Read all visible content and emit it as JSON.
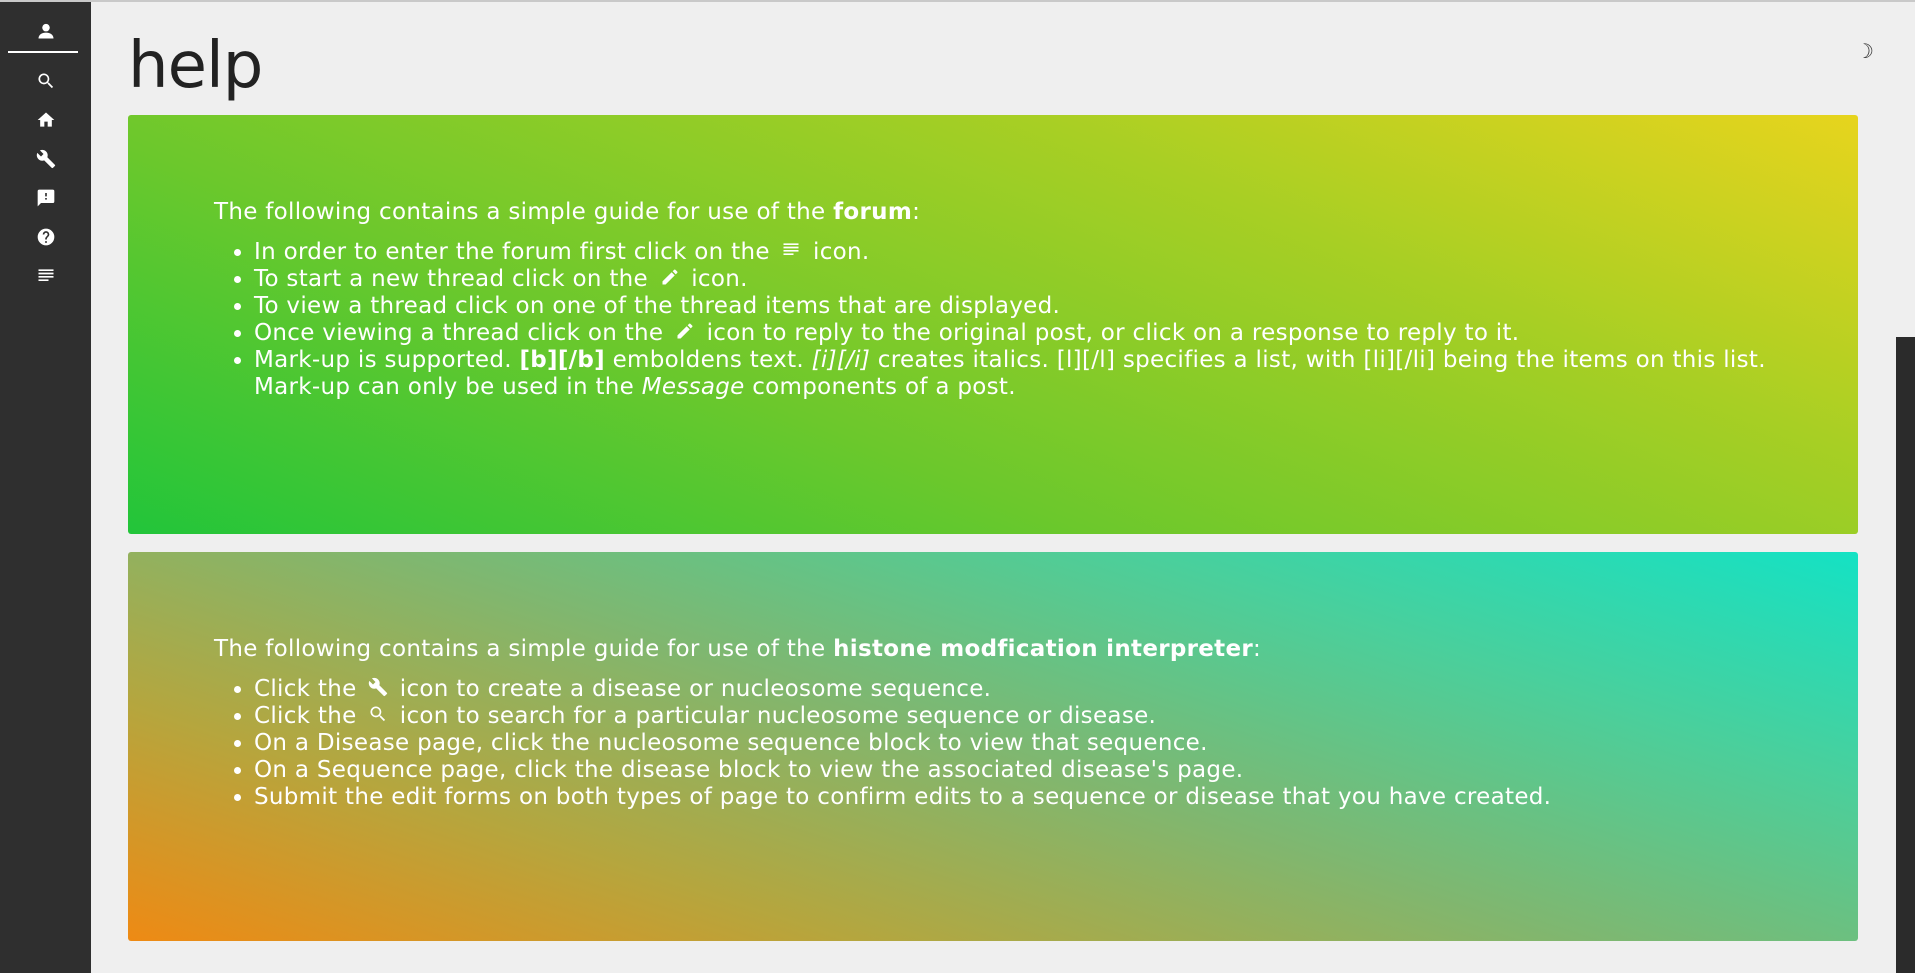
{
  "page": {
    "title": "help",
    "theme_toggle_glyph": "☽"
  },
  "sidebar": {
    "items": [
      {
        "name": "user-icon"
      },
      {
        "name": "search-icon"
      },
      {
        "name": "home-icon"
      },
      {
        "name": "wrench-icon"
      },
      {
        "name": "feedback-icon"
      },
      {
        "name": "help-icon"
      },
      {
        "name": "forum-icon"
      }
    ]
  },
  "forum": {
    "intro": "The following contains a simple guide for use of the ",
    "intro_bold": "forum",
    "intro_end": ":",
    "items": {
      "i1_a": "In order to enter the forum first click on the ",
      "i1_b": " icon.",
      "i2_a": "To start a new thread click on the ",
      "i2_b": " icon.",
      "i3": "To view a thread click on one of the thread items that are displayed.",
      "i4_a": "Once viewing a thread click on the ",
      "i4_b": " icon to reply to the original post, or click on a response to reply to it.",
      "i5_a": "Mark-up is supported. ",
      "i5_bold": "[b][/b]",
      "i5_b": " emboldens text. ",
      "i5_ital": "[i][/i]",
      "i5_c": " creates italics. [l][/l] specifies a list, with [li][/li] being the items on this list. Mark-up can only be used in the ",
      "i5_msg": "Message",
      "i5_d": " components of a post."
    }
  },
  "histone": {
    "intro": "The following contains a simple guide for use of the ",
    "intro_bold": "histone modfication interpreter",
    "intro_end": ":",
    "items": {
      "i1_a": "Click the ",
      "i1_b": " icon to create a disease or nucleosome sequence.",
      "i2_a": "Click the ",
      "i2_b": " icon to search for a particular nucleosome sequence or disease.",
      "i3": "On a Disease page, click the nucleosome sequence block to view that sequence.",
      "i4": "On a Sequence page, click the disease block to view the associated disease's page.",
      "i5": "Submit the edit forms on both types of page to confirm edits to a sequence or disease that you have created."
    }
  }
}
